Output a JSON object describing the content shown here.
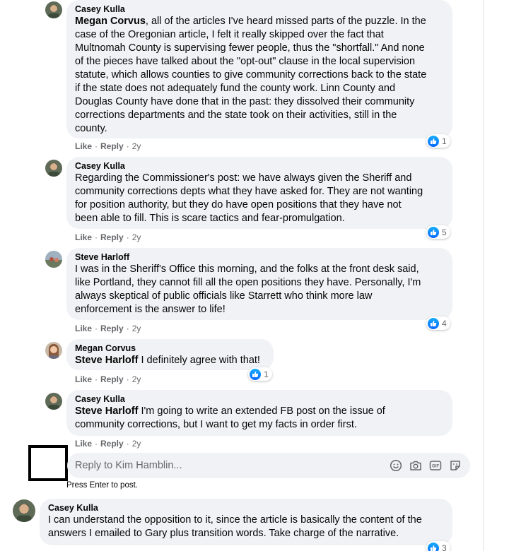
{
  "comments": [
    {
      "author": "Casey Kulla",
      "mention": "Megan Corvus",
      "lines": [
        ", all of the articles I've heard missed parts of the puzzle. In the",
        "case of the Oregonian article, I felt it really skipped over the fact that",
        "Multnomah County is supervising fewer people, thus the \"shortfall.\" And none",
        "of the pieces have talked about the \"opt-out\" clause in the local supervision",
        "statute, which allows counties to give community corrections back to the state",
        "if the state does not adequately fund the county work. Linn County and",
        "Douglas County have done that in the past: they dissolved their community",
        "corrections departments and the state took on their activities, still in the",
        "county."
      ],
      "like_label": "Like",
      "reply_label": "Reply",
      "time": "2y",
      "reactions": "1"
    },
    {
      "author": "Casey Kulla",
      "mention": "",
      "lines": [
        "Regarding the Commissioner's post: we have always given the Sheriff and",
        "community corrections depts what they have asked for. They are not wanting",
        "for position authority, but they do have open positions that they have not",
        "been able to fill. This is scare tactics and fear-promulgation."
      ],
      "like_label": "Like",
      "reply_label": "Reply",
      "time": "2y",
      "reactions": "5"
    },
    {
      "author": "Steve Harloff",
      "mention": "",
      "lines": [
        "I was in the Sheriff's Office this morning, and the folks at the front desk said,",
        "like Portland, they cannot fill all the open positions they have. Personally, I'm",
        "always skeptical of public officials like Starrett who think more law",
        "enforcement is the answer to life!"
      ],
      "like_label": "Like",
      "reply_label": "Reply",
      "time": "2y",
      "reactions": "4"
    },
    {
      "author": "Megan Corvus",
      "mention": "Steve Harloff",
      "lines": [
        " I definitely agree with that!"
      ],
      "like_label": "Like",
      "reply_label": "Reply",
      "time": "2y",
      "reactions": "1"
    },
    {
      "author": "Casey Kulla",
      "mention": "Steve Harloff",
      "lines": [
        " I'm going to write an extended FB post on the issue of",
        "community corrections, but I want to get my facts in order first."
      ],
      "like_label": "Like",
      "reply_label": "Reply",
      "time": "2y",
      "reactions": ""
    }
  ],
  "reply": {
    "placeholder": "Reply to Kim Hamblin...",
    "hint": "Press Enter to post."
  },
  "top_comment": {
    "author": "Casey Kulla",
    "lines": [
      "I can understand the opposition to it, since the article is basically the content of the",
      "answers I emailed to Gary plus transition words. Take charge of the narrative."
    ],
    "reactions": "3"
  },
  "icons": [
    "like-icon",
    "emoji-icon",
    "camera-icon",
    "gif-icon",
    "sticker-icon"
  ],
  "colors": {
    "bubble": "#f0f2f5",
    "meta": "#65676b",
    "like": "#0866ff"
  }
}
